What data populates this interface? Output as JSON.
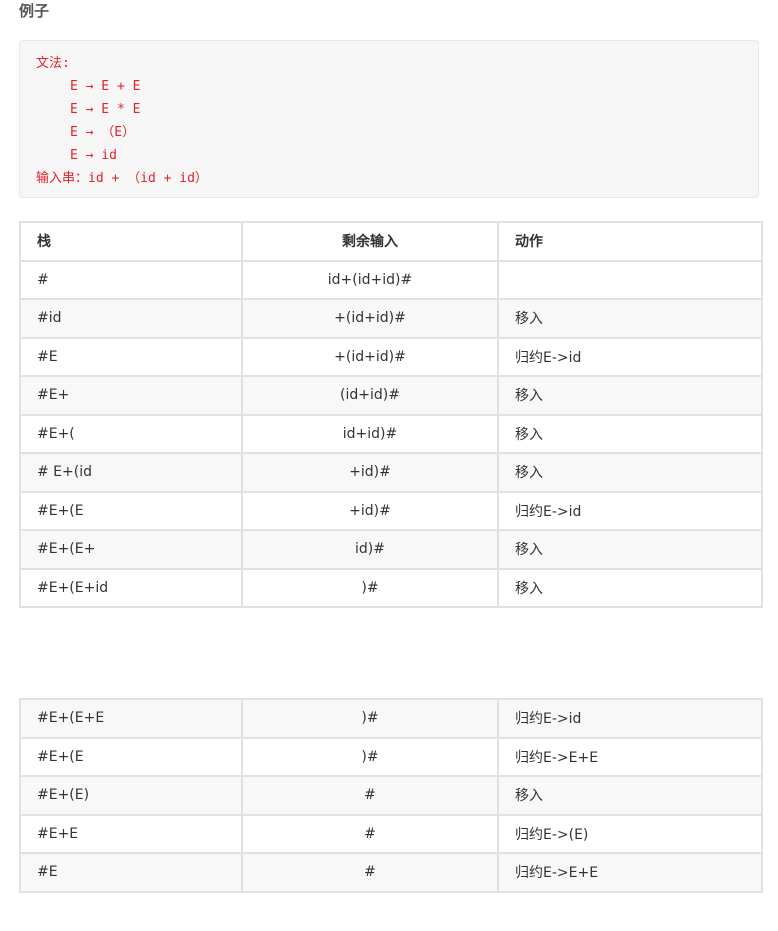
{
  "heading": "例子",
  "grammar": {
    "title": "文法:",
    "rules": [
      "E → E + E",
      "E → E * E",
      "E → （E）",
      "E → id"
    ],
    "input": "输入串：id + （id + id）"
  },
  "table": {
    "headers": [
      "栈",
      "剩余输入",
      "动作"
    ],
    "rows": [
      [
        "#",
        "id+(id+id)#",
        ""
      ],
      [
        "#id",
        "+(id+id)#",
        "移入"
      ],
      [
        "#E",
        "+(id+id)#",
        "归约E->id"
      ],
      [
        "#E+",
        "(id+id)#",
        "移入"
      ],
      [
        "#E+(",
        "id+id)#",
        "移入"
      ],
      [
        "# E+(id",
        "+id)#",
        "移入"
      ],
      [
        "#E+(E",
        "+id)#",
        "归约E->id"
      ],
      [
        "#E+(E+",
        "id)#",
        "移入"
      ],
      [
        "#E+(E+id",
        ")#",
        "移入"
      ]
    ]
  },
  "table2": {
    "rows": [
      [
        "#E+(E+E",
        ")#",
        "归约E->id"
      ],
      [
        "#E+(E",
        ")#",
        "归约E->E+E"
      ],
      [
        "#E+(E)",
        "#",
        "移入"
      ],
      [
        "#E+E",
        "#",
        "归约E->(E)"
      ],
      [
        "#E",
        "#",
        "归约E->E+E"
      ]
    ]
  }
}
